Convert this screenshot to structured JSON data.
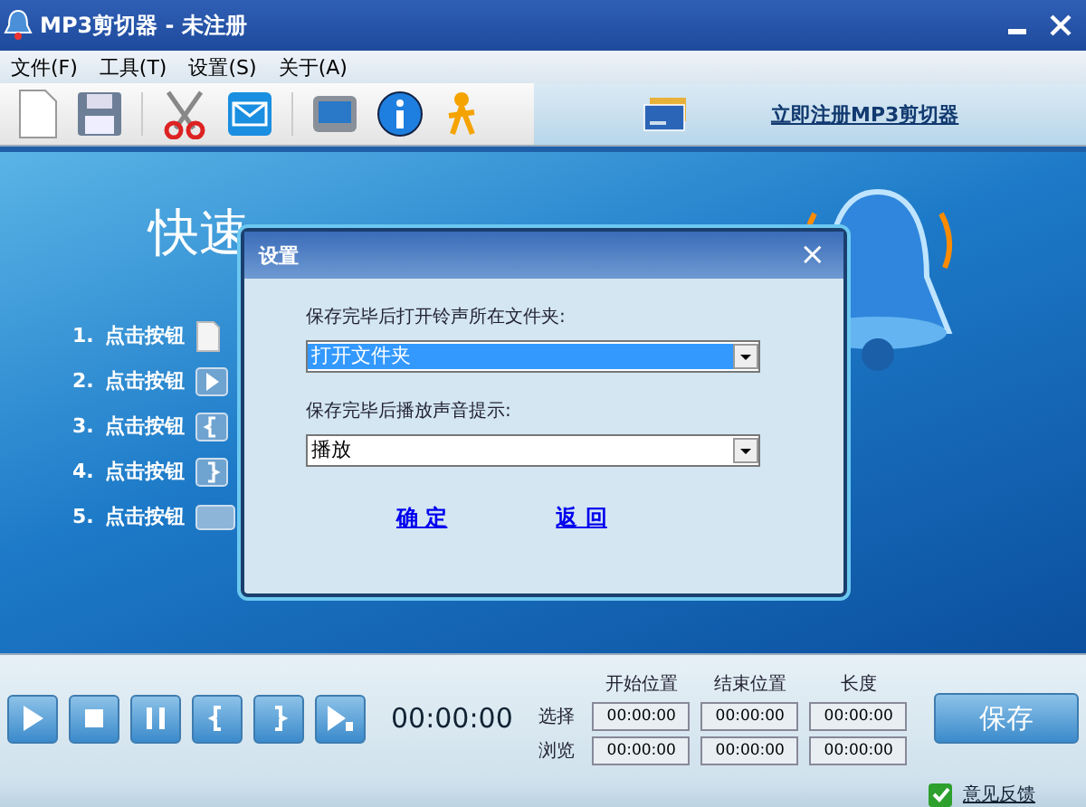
{
  "window": {
    "title": "MP3剪切器 - 未注册"
  },
  "menu": [
    "文件(F)",
    "工具(T)",
    "设置(S)",
    "关于(A)"
  ],
  "toolbar": {
    "register_link": "立即注册MP3剪切器"
  },
  "quick_start": {
    "heading": "快速",
    "steps": [
      {
        "number": "1.",
        "label": "点击按钮",
        "kind": "page"
      },
      {
        "number": "2.",
        "label": "点击按钮",
        "kind": "play"
      },
      {
        "number": "3.",
        "label": "点击按钮",
        "kind": "open"
      },
      {
        "number": "4.",
        "label": "点击按钮",
        "kind": "close"
      },
      {
        "number": "5.",
        "label": "点击按钮",
        "kind": "wide"
      }
    ]
  },
  "dialog": {
    "title": "设置",
    "close": "×",
    "fields": [
      {
        "label": "保存完毕后打开铃声所在文件夹:",
        "value": "打开文件夹",
        "focused": true
      },
      {
        "label": "保存完毕后播放声音提示:",
        "value": "播放",
        "focused": false
      }
    ],
    "buttons": [
      "确 定",
      "返 回"
    ]
  },
  "player": {
    "time": "00:00:00",
    "columns": [
      "开始位置",
      "结束位置",
      "长度"
    ],
    "rows": [
      {
        "label": "选择",
        "values": [
          "00:00:00",
          "00:00:00",
          "00:00:00"
        ]
      },
      {
        "label": "浏览",
        "values": [
          "00:00:00",
          "00:00:00",
          "00:00:00"
        ]
      }
    ],
    "save": "保存"
  },
  "status_bar": {
    "feedback": "意见反馈"
  }
}
